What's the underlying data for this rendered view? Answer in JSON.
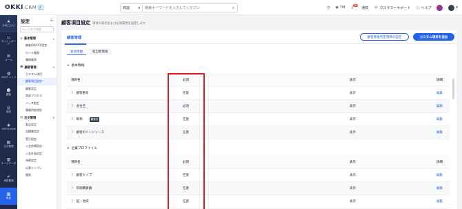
{
  "topbar": {
    "logo_text": "OKKI",
    "logo_suffix": "CRM",
    "logo_badge": "β",
    "search_scope": "商談",
    "search_placeholder": "検索キーワードを入力してください",
    "items": [
      {
        "label": "",
        "icon": "clock-icon"
      },
      {
        "label": "TM",
        "icon": "user-circle-icon"
      },
      {
        "label": "通知",
        "icon": "bell-icon",
        "badge": "99"
      },
      {
        "label": "カスタマーサポート",
        "icon": "headset-icon"
      },
      {
        "label": "ヘルプ",
        "icon": "help-icon"
      }
    ]
  },
  "leftnav": [
    {
      "label": "お気に入り",
      "icon": "star-icon"
    },
    {
      "label": "ダッシュボード",
      "icon": "dashboard-icon"
    },
    {
      "label": "メール",
      "icon": "mail-icon"
    },
    {
      "label": "SNSチャット",
      "icon": "chat-icon"
    },
    {
      "label": "顧客",
      "icon": "customer-icon"
    },
    {
      "label": "商談",
      "icon": "deal-icon"
    },
    {
      "label": "OKKI Leads",
      "icon": "leads-icon"
    },
    {
      "label": "注文管理",
      "icon": "order-icon"
    },
    {
      "label": "チームデータ",
      "icon": "chart-icon"
    },
    {
      "label": "承認管理",
      "icon": "approval-icon"
    },
    {
      "label": "設定",
      "icon": "settings-icon"
    }
  ],
  "subnav": {
    "title": "設定",
    "search_placeholder": "ページ名で検索",
    "groups": [
      {
        "label": "基本管理",
        "items": [
          "機能ON/OFF設定",
          "ロール権限",
          "職務権限"
        ]
      },
      {
        "label": "顧客管理",
        "items": [
          "カスタム項目",
          "顧客項目設定",
          "顧客設定",
          "商談プロセス",
          "ソース設定",
          "重複判定設定"
        ]
      },
      {
        "label": "注文管理",
        "items": [
          "製品設定",
          "見積書設定",
          "受注設定",
          "入金依頼設定",
          "入金計画設定",
          "為替設定",
          "伝票テンプレ",
          "権限"
        ]
      }
    ],
    "active": "顧客項目設定"
  },
  "page": {
    "title": "顧客項目設定",
    "subtitle": "項目の表示および必須属性を設定します"
  },
  "card": {
    "title": "顧客管理",
    "btn_outline": "顧客重複判定項目の設定",
    "btn_primary": "カスタム項目を追加",
    "tabs": [
      "会社情報",
      "担当者情報"
    ]
  },
  "sections": [
    {
      "title": "基本情報",
      "headers": [
        "項目名",
        "必須",
        "表示",
        "詳細"
      ],
      "rows": [
        {
          "name": "顧客番号",
          "required": "任意",
          "display": "表示",
          "action": "編集"
        },
        {
          "name": "会社名",
          "required": "必須",
          "display": "表示",
          "action": "編集"
        },
        {
          "name": "略称",
          "required": "任意",
          "display": "表示",
          "action": "編集",
          "tooltip": "顧客名"
        },
        {
          "name": "顧客のリードソース",
          "required": "任意",
          "display": "表示",
          "action": "編集"
        }
      ]
    },
    {
      "title": "企業プロファイル",
      "headers": [
        "項目名",
        "必須",
        "表示",
        "詳細"
      ],
      "rows": [
        {
          "name": "顧客タイプ",
          "required": "任意",
          "display": "表示",
          "action": "編集"
        },
        {
          "name": "年間購買額",
          "required": "任意",
          "display": "表示",
          "action": "編集"
        },
        {
          "name": "国・地域",
          "required": "任意",
          "display": "表示",
          "action": "編集"
        }
      ]
    }
  ],
  "colors": {
    "accent": "#2563eb",
    "nav_bg": "#1e2a4a",
    "highlight": "#e11d1d"
  }
}
